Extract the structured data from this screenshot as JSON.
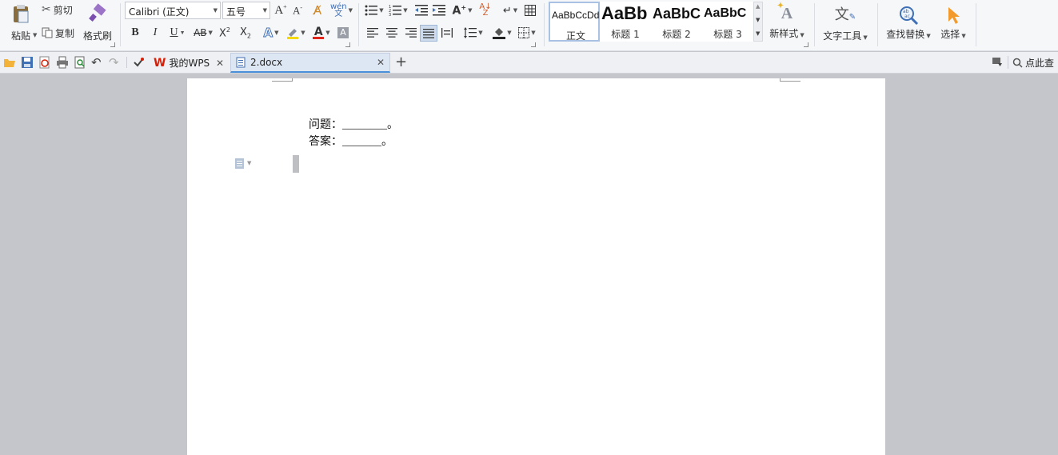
{
  "clipboard": {
    "paste": "粘贴",
    "cut": "剪切",
    "copy": "复制",
    "format_painter": "格式刷"
  },
  "font": {
    "family": "Calibri (正文)",
    "size": "五号"
  },
  "styles": [
    {
      "sample": "AaBbCcDd",
      "name": "正文"
    },
    {
      "sample": "AaBb",
      "name": "标题 1"
    },
    {
      "sample": "AaBbC",
      "name": "标题 2"
    },
    {
      "sample": "AaBbC",
      "name": "标题 3"
    }
  ],
  "new_style": "新样式",
  "text_tools": "文字工具",
  "find_replace": "查找替换",
  "select": "选择",
  "tabs": {
    "mywps": "我的WPS",
    "doc": "2.docx"
  },
  "search_hint": "点此查",
  "document": {
    "lines": [
      {
        "label": "问题：",
        "blank": "________",
        "end": "。"
      },
      {
        "label": "答案：",
        "blank": "_______",
        "end": "。"
      }
    ]
  },
  "colors": {
    "accent": "#4a90d9",
    "highlight": "#f5d800",
    "font_red": "#e0251b",
    "wps_red": "#d81e06"
  }
}
